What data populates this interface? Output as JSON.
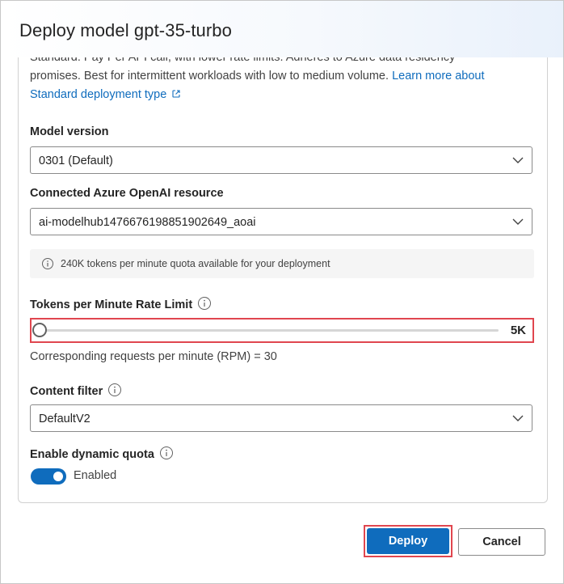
{
  "dialog": {
    "title": "Deploy model gpt-35-turbo"
  },
  "description": {
    "line1": "Standard: Pay Per API call, with lower rate limits. Adheres to Azure data residency",
    "line2_text": "promises. Best for intermittent workloads with low to medium volume. ",
    "link_part1": "Learn more about",
    "link_part2": "Standard deployment type",
    "link_icon": "external-link-icon"
  },
  "model_version": {
    "label": "Model version",
    "value": "0301 (Default)"
  },
  "resource": {
    "label": "Connected Azure OpenAI resource",
    "value": "ai-modelhub1476676198851902649_aoai"
  },
  "quota_info": {
    "text": "240K tokens per minute quota available for your deployment",
    "icon": "info-icon"
  },
  "rate_limit": {
    "label": "Tokens per Minute Rate Limit",
    "value_label": "5K",
    "position_fraction": 0
  },
  "rpm": {
    "text": "Corresponding requests per minute (RPM) = 30"
  },
  "content_filter": {
    "label": "Content filter",
    "value": "DefaultV2"
  },
  "dynamic_quota": {
    "label": "Enable dynamic quota",
    "state_label": "Enabled",
    "enabled": true
  },
  "buttons": {
    "deploy": "Deploy",
    "cancel": "Cancel"
  },
  "colors": {
    "accent": "#0f6cbd",
    "highlight": "#e0464f"
  }
}
